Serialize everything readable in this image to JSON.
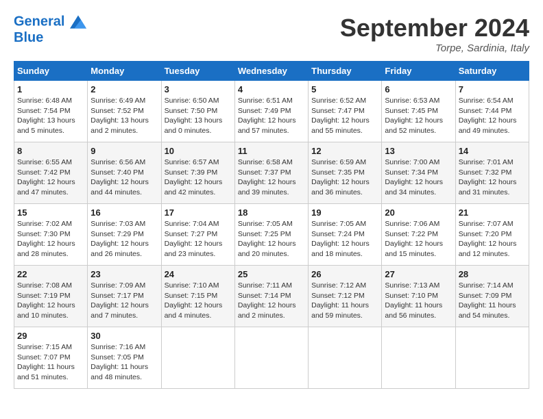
{
  "header": {
    "logo_line1": "General",
    "logo_line2": "Blue",
    "month_year": "September 2024",
    "location": "Torpe, Sardinia, Italy"
  },
  "days_of_week": [
    "Sunday",
    "Monday",
    "Tuesday",
    "Wednesday",
    "Thursday",
    "Friday",
    "Saturday"
  ],
  "weeks": [
    [
      {
        "day": "1",
        "sunrise": "6:48 AM",
        "sunset": "7:54 PM",
        "daylight": "13 hours and 5 minutes."
      },
      {
        "day": "2",
        "sunrise": "6:49 AM",
        "sunset": "7:52 PM",
        "daylight": "13 hours and 2 minutes."
      },
      {
        "day": "3",
        "sunrise": "6:50 AM",
        "sunset": "7:50 PM",
        "daylight": "13 hours and 0 minutes."
      },
      {
        "day": "4",
        "sunrise": "6:51 AM",
        "sunset": "7:49 PM",
        "daylight": "12 hours and 57 minutes."
      },
      {
        "day": "5",
        "sunrise": "6:52 AM",
        "sunset": "7:47 PM",
        "daylight": "12 hours and 55 minutes."
      },
      {
        "day": "6",
        "sunrise": "6:53 AM",
        "sunset": "7:45 PM",
        "daylight": "12 hours and 52 minutes."
      },
      {
        "day": "7",
        "sunrise": "6:54 AM",
        "sunset": "7:44 PM",
        "daylight": "12 hours and 49 minutes."
      }
    ],
    [
      {
        "day": "8",
        "sunrise": "6:55 AM",
        "sunset": "7:42 PM",
        "daylight": "12 hours and 47 minutes."
      },
      {
        "day": "9",
        "sunrise": "6:56 AM",
        "sunset": "7:40 PM",
        "daylight": "12 hours and 44 minutes."
      },
      {
        "day": "10",
        "sunrise": "6:57 AM",
        "sunset": "7:39 PM",
        "daylight": "12 hours and 42 minutes."
      },
      {
        "day": "11",
        "sunrise": "6:58 AM",
        "sunset": "7:37 PM",
        "daylight": "12 hours and 39 minutes."
      },
      {
        "day": "12",
        "sunrise": "6:59 AM",
        "sunset": "7:35 PM",
        "daylight": "12 hours and 36 minutes."
      },
      {
        "day": "13",
        "sunrise": "7:00 AM",
        "sunset": "7:34 PM",
        "daylight": "12 hours and 34 minutes."
      },
      {
        "day": "14",
        "sunrise": "7:01 AM",
        "sunset": "7:32 PM",
        "daylight": "12 hours and 31 minutes."
      }
    ],
    [
      {
        "day": "15",
        "sunrise": "7:02 AM",
        "sunset": "7:30 PM",
        "daylight": "12 hours and 28 minutes."
      },
      {
        "day": "16",
        "sunrise": "7:03 AM",
        "sunset": "7:29 PM",
        "daylight": "12 hours and 26 minutes."
      },
      {
        "day": "17",
        "sunrise": "7:04 AM",
        "sunset": "7:27 PM",
        "daylight": "12 hours and 23 minutes."
      },
      {
        "day": "18",
        "sunrise": "7:05 AM",
        "sunset": "7:25 PM",
        "daylight": "12 hours and 20 minutes."
      },
      {
        "day": "19",
        "sunrise": "7:05 AM",
        "sunset": "7:24 PM",
        "daylight": "12 hours and 18 minutes."
      },
      {
        "day": "20",
        "sunrise": "7:06 AM",
        "sunset": "7:22 PM",
        "daylight": "12 hours and 15 minutes."
      },
      {
        "day": "21",
        "sunrise": "7:07 AM",
        "sunset": "7:20 PM",
        "daylight": "12 hours and 12 minutes."
      }
    ],
    [
      {
        "day": "22",
        "sunrise": "7:08 AM",
        "sunset": "7:19 PM",
        "daylight": "12 hours and 10 minutes."
      },
      {
        "day": "23",
        "sunrise": "7:09 AM",
        "sunset": "7:17 PM",
        "daylight": "12 hours and 7 minutes."
      },
      {
        "day": "24",
        "sunrise": "7:10 AM",
        "sunset": "7:15 PM",
        "daylight": "12 hours and 4 minutes."
      },
      {
        "day": "25",
        "sunrise": "7:11 AM",
        "sunset": "7:14 PM",
        "daylight": "12 hours and 2 minutes."
      },
      {
        "day": "26",
        "sunrise": "7:12 AM",
        "sunset": "7:12 PM",
        "daylight": "11 hours and 59 minutes."
      },
      {
        "day": "27",
        "sunrise": "7:13 AM",
        "sunset": "7:10 PM",
        "daylight": "11 hours and 56 minutes."
      },
      {
        "day": "28",
        "sunrise": "7:14 AM",
        "sunset": "7:09 PM",
        "daylight": "11 hours and 54 minutes."
      }
    ],
    [
      {
        "day": "29",
        "sunrise": "7:15 AM",
        "sunset": "7:07 PM",
        "daylight": "11 hours and 51 minutes."
      },
      {
        "day": "30",
        "sunrise": "7:16 AM",
        "sunset": "7:05 PM",
        "daylight": "11 hours and 48 minutes."
      },
      null,
      null,
      null,
      null,
      null
    ]
  ]
}
